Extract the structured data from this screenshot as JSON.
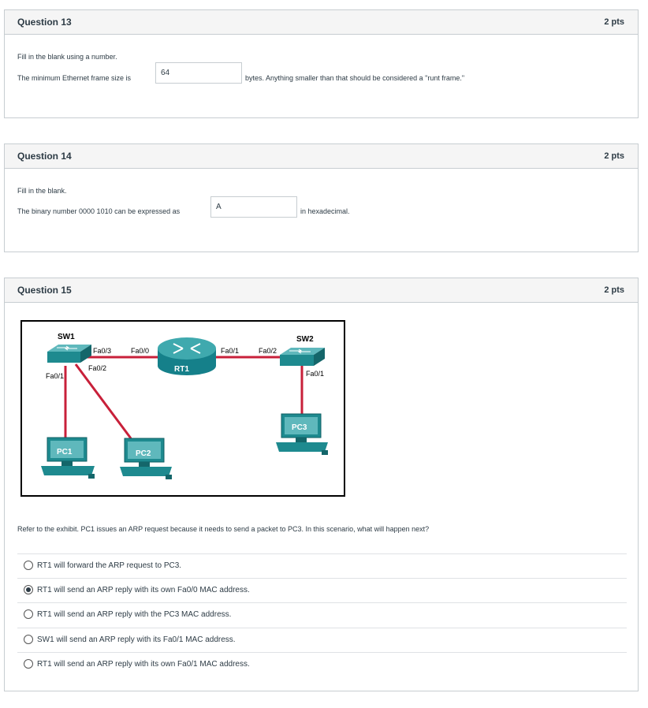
{
  "q13": {
    "title": "Question 13",
    "points": "2 pts",
    "instruction": "Fill in the blank using a number.",
    "prefix": "The minimum Ethernet frame size is",
    "answer": "64",
    "suffix": "bytes. Anything smaller than that should be considered a \"runt frame.\""
  },
  "q14": {
    "title": "Question 14",
    "points": "2 pts",
    "instruction": "Fill in the blank.",
    "prefix": "The binary number 0000 1010 can be expressed as",
    "answer": "A",
    "suffix": "in hexadecimal."
  },
  "q15": {
    "title": "Question 15",
    "points": "2 pts",
    "exhibit": {
      "sw1": "SW1",
      "sw2": "SW2",
      "rt1": "RT1",
      "pc1": "PC1",
      "pc2": "PC2",
      "pc3": "PC3",
      "sw1_fa03": "Fa0/3",
      "sw1_fa02": "Fa0/2",
      "sw1_fa01": "Fa0/1",
      "rt1_fa00": "Fa0/0",
      "rt1_fa01": "Fa0/1",
      "sw2_fa02": "Fa0/2",
      "sw2_fa01": "Fa0/1",
      "colors": {
        "device": "#1e8a8f",
        "link": "#c8203a",
        "router": "#15808a"
      }
    },
    "prompt": "Refer to the exhibit. PC1 issues an ARP request because it needs to send a packet to PC3. In this scenario, what will happen next?",
    "options": [
      "RT1 will forward the ARP request to PC3.",
      "RT1 will send an ARP reply with its own Fa0/0 MAC address.",
      "RT1 will send an ARP reply with the PC3 MAC address.",
      "SW1 will send an ARP reply with its Fa0/1 MAC address.",
      "RT1 will send an ARP reply with its own Fa0/1 MAC address."
    ],
    "selected_index": 1
  }
}
